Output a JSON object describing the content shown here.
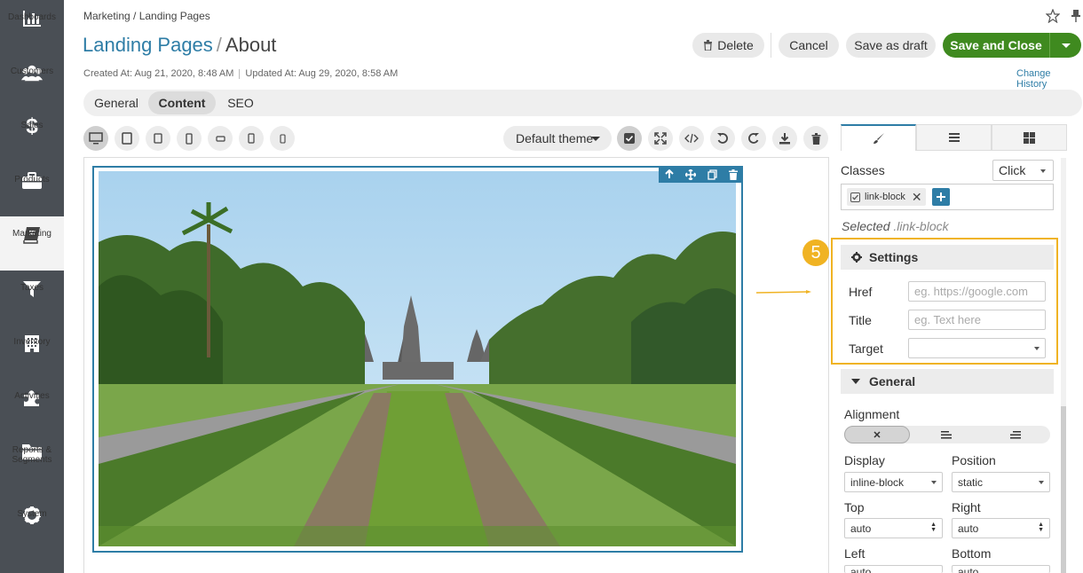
{
  "sidebar": {
    "items": [
      {
        "label": "Dashboards",
        "icon": "dashboards-icon"
      },
      {
        "label": "Customers",
        "icon": "customers-icon"
      },
      {
        "label": "Sales",
        "icon": "sales-icon"
      },
      {
        "label": "Products",
        "icon": "products-icon"
      },
      {
        "label": "Marketing",
        "icon": "marketing-icon",
        "active": true
      },
      {
        "label": "Taxes",
        "icon": "taxes-icon"
      },
      {
        "label": "Inventory",
        "icon": "inventory-icon"
      },
      {
        "label": "Activities",
        "icon": "activities-icon"
      },
      {
        "label": "Reports &\nSegments",
        "icon": "reports-icon"
      },
      {
        "label": "System",
        "icon": "system-icon"
      }
    ]
  },
  "header": {
    "breadcrumb": "Marketing / Landing Pages",
    "title_parent": "Landing Pages",
    "title_sep": "/",
    "title_current": "About",
    "created": "Created At: Aug 21, 2020, 8:48 AM",
    "updated": "Updated At: Aug 29, 2020, 8:58 AM",
    "change_history": "Change History"
  },
  "actions": {
    "delete": "Delete",
    "cancel": "Cancel",
    "save_draft": "Save as draft",
    "save_close": "Save and Close"
  },
  "tabs": [
    {
      "label": "General"
    },
    {
      "label": "Content",
      "active": true
    },
    {
      "label": "SEO"
    }
  ],
  "toolbar": {
    "theme": "Default theme"
  },
  "right_panel": {
    "classes_label": "Classes",
    "classes_state": "Click",
    "tag": "link-block",
    "selected_prefix": "Selected",
    "selected_class": ".link-block",
    "step_badge": "5",
    "settings": {
      "title": "Settings",
      "href_label": "Href",
      "href_placeholder": "eg. https://google.com",
      "title_label": "Title",
      "title_placeholder": "eg. Text here",
      "target_label": "Target",
      "target_value": ""
    },
    "general": {
      "title": "General",
      "alignment_label": "Alignment",
      "display_label": "Display",
      "display_value": "inline-block",
      "position_label": "Position",
      "position_value": "static",
      "top_label": "Top",
      "top_value": "auto",
      "right_label": "Right",
      "right_value": "auto",
      "left_label": "Left",
      "bottom_label": "Bottom",
      "left_value": "auto",
      "bottom_value": "auto"
    }
  },
  "colors": {
    "accent": "#2e7da6",
    "primary_button": "#3f8a1f",
    "highlight": "#f0b323",
    "sidebar": "#4a4f55"
  }
}
